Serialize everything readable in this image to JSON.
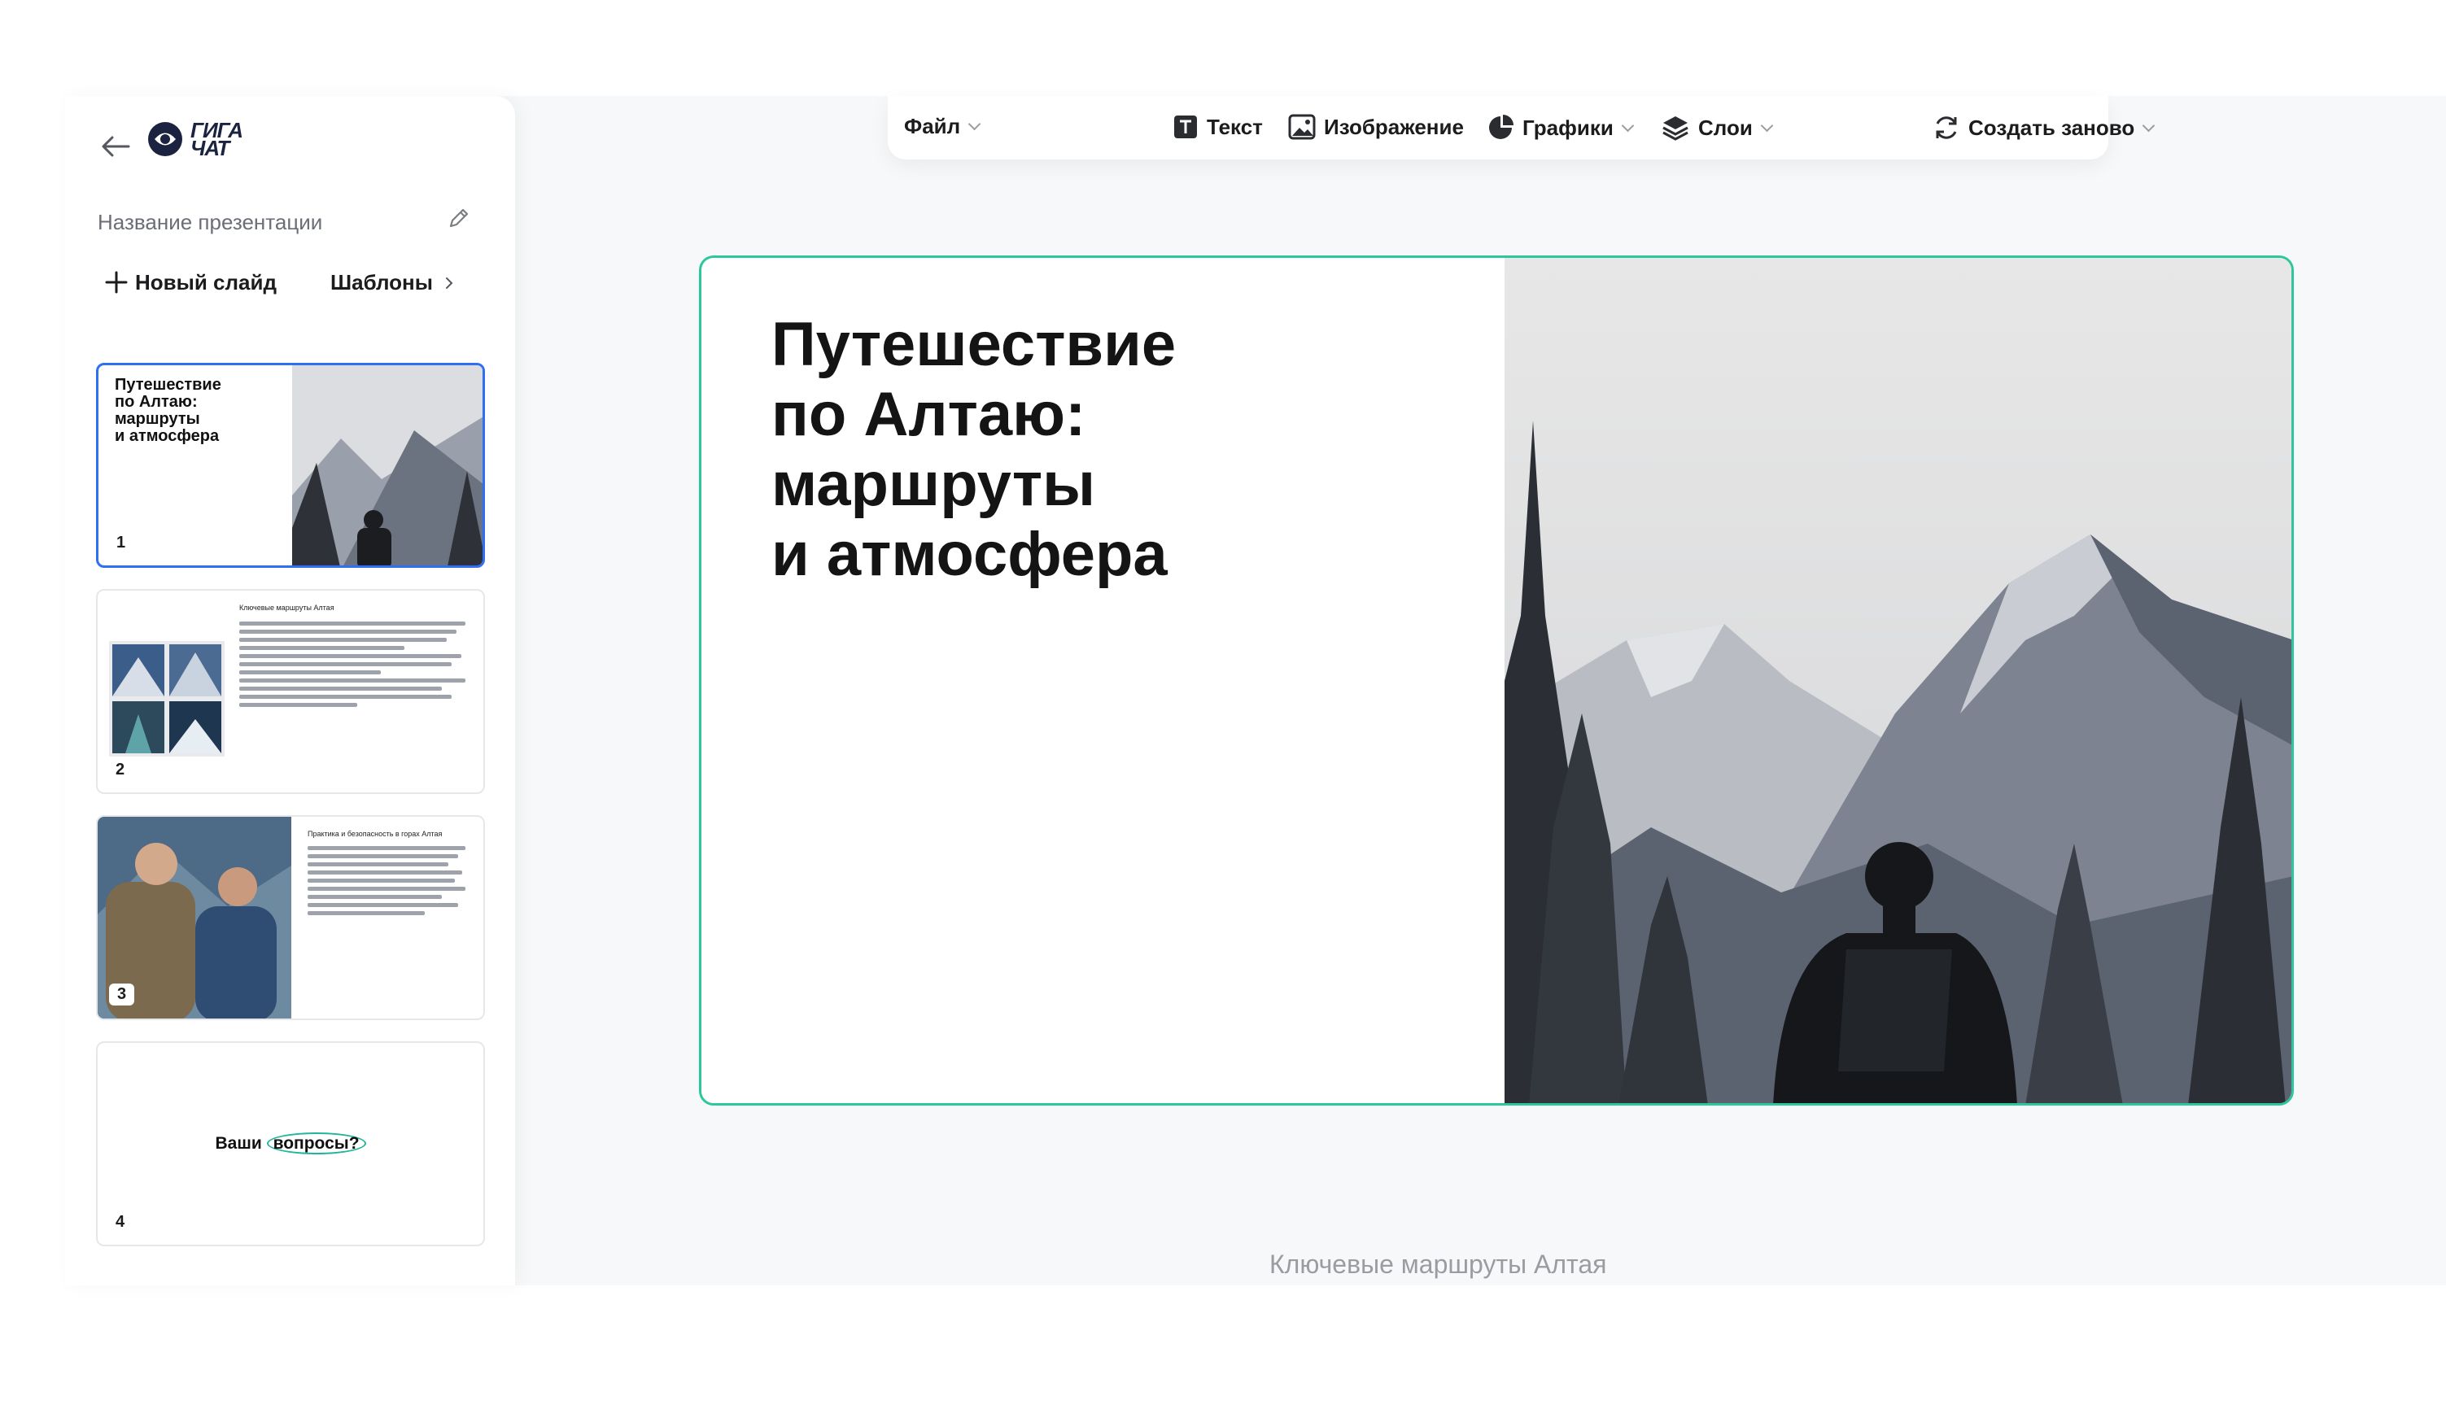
{
  "app": {
    "logo_line1": "ГИГА",
    "logo_line2": "ЧАТ",
    "presentation_name_label": "Название презентации",
    "new_slide_label": "Новый слайд",
    "templates_label": "Шаблоны"
  },
  "toolbar": {
    "file": "Файл",
    "text": "Текст",
    "image": "Изображение",
    "charts": "Графики",
    "layers": "Слои",
    "regenerate": "Создать заново"
  },
  "slides": [
    {
      "number": "1",
      "title": "Путешествие по Алтаю: маршруты и атмосфера",
      "title_lines": [
        "Путешествие",
        "по Алтаю:",
        "маршруты",
        "и атмосфера"
      ]
    },
    {
      "number": "2",
      "title": "Ключевые маршруты Алтая"
    },
    {
      "number": "3",
      "title": "Практика и безопасность в горах Алтая"
    },
    {
      "number": "4",
      "title_part1": "Ваши ",
      "title_part2": "вопросы?"
    }
  ],
  "main_slide": {
    "title_lines": [
      "Путешествие",
      "по Алтаю:",
      "маршруты",
      "и атмосфера"
    ]
  },
  "next_slide_label": "Ключевые маршруты Алтая",
  "colors": {
    "accent_border": "#2ec79b",
    "active_thumb_border": "#2f6ff2",
    "logo": "#1b2340"
  }
}
